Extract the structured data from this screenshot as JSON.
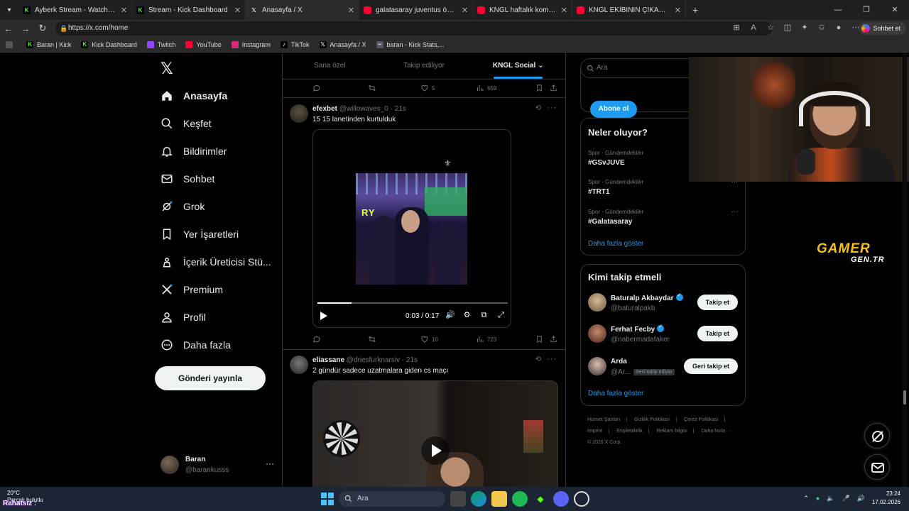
{
  "browser": {
    "tabs": [
      {
        "title": "Ayberk Stream - Watch Live on Kick",
        "icon": "kick-icon",
        "color": "#53fc18",
        "active": false
      },
      {
        "title": "Stream - Kick Dashboard",
        "icon": "kick-icon",
        "color": "#53fc18",
        "active": false
      },
      {
        "title": "Anasayfa / X",
        "icon": "x-icon",
        "color": "#ffffff",
        "active": true
      },
      {
        "title": "galatasaray juventus özet - YouTube",
        "icon": "youtube-icon",
        "color": "#ff0033",
        "active": false
      },
      {
        "title": "KNGL haftalık komik anlar | BÖLÜM",
        "icon": "youtube-icon",
        "color": "#ff0033",
        "active": false
      },
      {
        "title": "KNGL EKİBİNİN ÇIKARDIĞI ŞARKILAR",
        "icon": "youtube-icon",
        "color": "#ff0033",
        "active": false
      }
    ],
    "url": "https://x.com/home",
    "copilot_label": "Sohbet et",
    "bookmarks": [
      {
        "label": "Baran | Kick",
        "icon": "kick-icon"
      },
      {
        "label": "Kick Dashboard",
        "icon": "kick-icon"
      },
      {
        "label": "Twitch",
        "icon": "twitch-icon"
      },
      {
        "label": "YouTube",
        "icon": "youtube-icon"
      },
      {
        "label": "Instagram",
        "icon": "instagram-icon"
      },
      {
        "label": "TikTok",
        "icon": "tiktok-icon"
      },
      {
        "label": "Anasayfa / X",
        "icon": "x-icon"
      },
      {
        "label": "baran - Kick Stats,...",
        "icon": "stats-icon"
      }
    ]
  },
  "nav": {
    "items": [
      {
        "label": "Anasayfa",
        "icon": "home-icon"
      },
      {
        "label": "Keşfet",
        "icon": "search-icon"
      },
      {
        "label": "Bildirimler",
        "icon": "bell-icon"
      },
      {
        "label": "Sohbet",
        "icon": "mail-icon"
      },
      {
        "label": "Grok",
        "icon": "grok-icon"
      },
      {
        "label": "Yer İşaretleri",
        "icon": "bookmark-icon"
      },
      {
        "label": "İçerik Üreticisi Stü...",
        "icon": "creator-studio-icon"
      },
      {
        "label": "Premium",
        "icon": "x-icon"
      },
      {
        "label": "Profil",
        "icon": "person-icon"
      },
      {
        "label": "Daha fazla",
        "icon": "more-circle-icon"
      }
    ],
    "post_button": "Gönderi yayınla",
    "profile": {
      "name": "Baran",
      "handle": "@barankusss"
    }
  },
  "feed": {
    "tabs": [
      "Sana özel",
      "Takip ediliyor",
      "KNGL Social"
    ],
    "top_actions": {
      "likes": "5",
      "views": "659"
    },
    "tweets": [
      {
        "name": "efexbet",
        "handle": "@willowaves_0",
        "time": "21s",
        "text": "15 15 lanetinden kurtulduk",
        "video": {
          "time": "0:03 / 0:17",
          "progress": 0.18,
          "overlay_text": "RY"
        },
        "likes": "10",
        "views": "723"
      },
      {
        "name": "eliassane",
        "handle": "@driesfurknarsiv",
        "time": "21s",
        "text": "2 gündür sadece uzatmalara giden cs maçı"
      }
    ]
  },
  "sidebar": {
    "search_placeholder": "Ara",
    "subscribe_label": "Abone ol",
    "trends_title": "Neler oluyor?",
    "trends": [
      {
        "meta": "Spor · Gündemdekiler",
        "tag": "#GSvJUVE"
      },
      {
        "meta": "Spor · Gündemdekiler",
        "tag": "#TRT1"
      },
      {
        "meta": "Spor · Gündemdekiler",
        "tag": "#Galatasaray"
      }
    ],
    "show_more": "Daha fazla göster",
    "follow_title": "Kimi takip etmeli",
    "follow": [
      {
        "name": "Baturalp Akbaydar",
        "handle": "@baturalpakb",
        "verified": true,
        "button": "Takip et"
      },
      {
        "name": "Ferhat Fecby",
        "handle": "@nabermadafaker",
        "verified": true,
        "button": "Takip et"
      },
      {
        "name": "Arda",
        "handle": "@Ar...",
        "verified": false,
        "follows_you": "Seni takip ediyor",
        "button": "Geri takip et"
      }
    ],
    "footer": [
      "Hizmet Şartları",
      "Gizlilik Politikası",
      "Çerez Politikası",
      "Imprint",
      "Erişilebilirlik",
      "Reklam bilgisi",
      "Daha fazla ···",
      "© 2026 X Corp."
    ]
  },
  "overlay": {
    "brand_top": "GAMER",
    "brand_bottom": "GEN.TR"
  },
  "taskbar": {
    "weather_temp": "20°C",
    "weather_text": "Parçalı bulutlu",
    "overlay_label": "Rahatsız :",
    "search": "Ara",
    "time": "23:24",
    "date": "17.02.2026"
  },
  "colors": {
    "accent": "#1d9bf0",
    "background": "#000000",
    "border": "#2f3336",
    "kick": "#53fc18"
  }
}
